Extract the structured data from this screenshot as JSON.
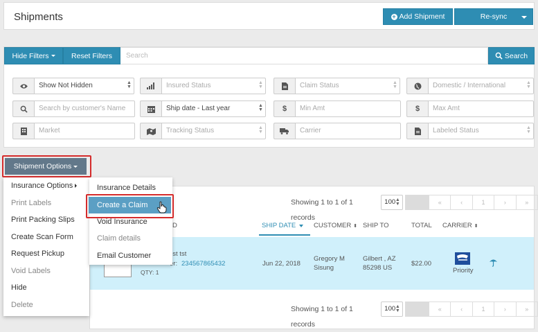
{
  "header": {
    "title": "Shipments",
    "add_label": "Add Shipment",
    "resync_label": "Re-sync"
  },
  "filterbar": {
    "hide_label": "Hide Filters",
    "reset_label": "Reset Filters",
    "search_placeholder": "Search",
    "search_label": "Search"
  },
  "filters": {
    "hidden": "Show Not Hidden",
    "insured": "Insured Status",
    "claim": "Claim Status",
    "domestic": "Domestic / International",
    "customer": "Search by customer's Name",
    "shipdate": "Ship date - Last year",
    "min": "Min Amt",
    "max": "Max Amt",
    "market": "Market",
    "tracking": "Tracking Status",
    "carrier": "Carrier",
    "labeled": "Labeled Status"
  },
  "options": {
    "label": "Shipment Options"
  },
  "menu": {
    "insurance_options": "Insurance Options",
    "print_labels": "Print Labels",
    "print_packing": "Print Packing Slips",
    "create_scan": "Create Scan Form",
    "request_pickup": "Request Pickup",
    "void_labels": "Void Labels",
    "hide": "Hide",
    "delete": "Delete"
  },
  "submenu": {
    "details": "Insurance Details",
    "create_claim": "Create a Claim",
    "void_insurance": "Void Insurance",
    "claim_details": "Claim details",
    "email_customer": "Email Customer"
  },
  "pager": {
    "records": "Showing 1 to 1 of 1 records",
    "per_page": "100",
    "page": "1",
    "first": "«",
    "prev": "‹",
    "next": "›",
    "last": "»"
  },
  "columns": {
    "partial": "D",
    "ship_date": "SHIP DATE",
    "customer": "CUSTOMER",
    "ship_to": "SHIP TO",
    "total": "TOTAL",
    "carrier": "CARRIER"
  },
  "row": {
    "name_partial": "est tst",
    "tracking_prefix": "er:",
    "tracking": "234567865432",
    "qty": "QTY: 1",
    "date": "Jun 22, 2018",
    "customer_first": "Gregory M",
    "customer_last": "Sisung",
    "city": "Gilbert , AZ",
    "zip": "85298 US",
    "total": "$22.00",
    "service": "Priority"
  },
  "colors": {
    "accent": "#2e8db3",
    "options_btn": "#62788a",
    "highlight_row": "#d0f0fb",
    "menu_highlight": "#5b9fc4",
    "callout": "#d42b2b"
  }
}
